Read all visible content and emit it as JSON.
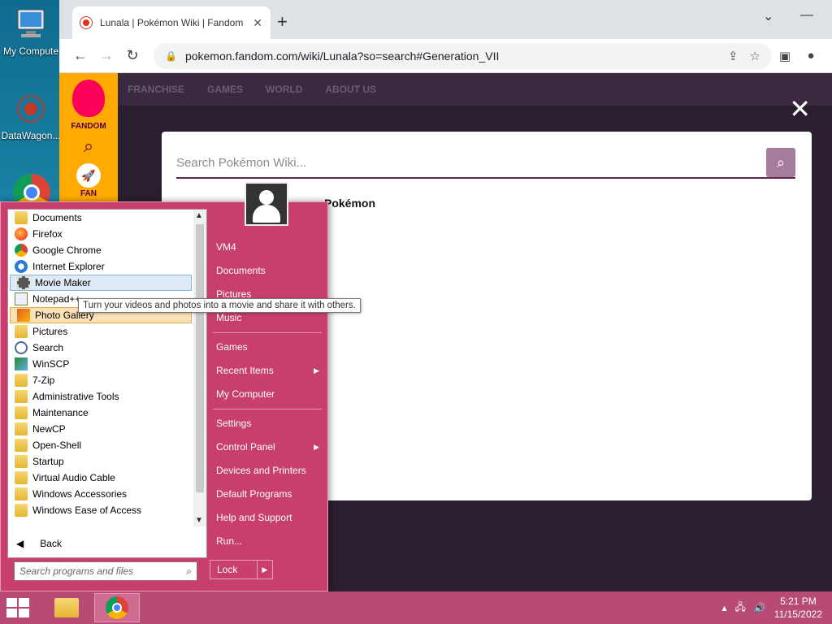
{
  "desktop": {
    "icons": [
      {
        "label": "My Compute"
      },
      {
        "label": "DataWagon..."
      }
    ]
  },
  "browser": {
    "tab_title": "Lunala | Pokémon Wiki | Fandom",
    "url": "pokemon.fandom.com/wiki/Lunala?so=search#Generation_VII",
    "nav": [
      "FRANCHISE",
      "GAMES",
      "WORLD",
      "ABOUT US"
    ],
    "fandom_label": "FANDOM",
    "fan_label": "FAN",
    "search": {
      "placeholder": "Search Pokémon Wiki...",
      "results_heading": "Pokémon"
    }
  },
  "startmenu": {
    "programs": [
      {
        "label": "Documents",
        "icon": "folder-docs-icon"
      },
      {
        "label": "Firefox",
        "icon": "firefox-icon"
      },
      {
        "label": "Google Chrome",
        "icon": "chrome-icon"
      },
      {
        "label": "Internet Explorer",
        "icon": "ie-icon"
      },
      {
        "label": "Movie Maker",
        "icon": "movie-maker-icon"
      },
      {
        "label": "Notepad++",
        "icon": "notepad-icon"
      },
      {
        "label": "Photo Gallery",
        "icon": "photo-gallery-icon"
      },
      {
        "label": "Pictures",
        "icon": "folder-pictures-icon"
      },
      {
        "label": "Search",
        "icon": "search-icon"
      },
      {
        "label": "WinSCP",
        "icon": "winscp-icon"
      },
      {
        "label": "7-Zip",
        "icon": "folder-icon"
      },
      {
        "label": "Administrative Tools",
        "icon": "folder-icon"
      },
      {
        "label": "Maintenance",
        "icon": "folder-icon"
      },
      {
        "label": "NewCP",
        "icon": "folder-icon"
      },
      {
        "label": "Open-Shell",
        "icon": "folder-icon"
      },
      {
        "label": "Startup",
        "icon": "folder-icon"
      },
      {
        "label": "Virtual Audio Cable",
        "icon": "folder-icon"
      },
      {
        "label": "Windows Accessories",
        "icon": "folder-icon"
      },
      {
        "label": "Windows Ease of Access",
        "icon": "folder-icon"
      }
    ],
    "back_label": "Back",
    "search_placeholder": "Search programs and files",
    "right_items": {
      "user": "VM4",
      "documents": "Documents",
      "pictures": "Pictures",
      "music": "Music",
      "games": "Games",
      "recent": "Recent Items",
      "computer": "My Computer",
      "settings": "Settings",
      "control_panel": "Control Panel",
      "devices": "Devices and Printers",
      "default_programs": "Default Programs",
      "help": "Help and Support",
      "run": "Run..."
    },
    "lock_label": "Lock",
    "tooltip": "Turn your videos and photos into a movie and share it with others."
  },
  "taskbar": {
    "time": "5:21 PM",
    "date": "11/15/2022"
  }
}
